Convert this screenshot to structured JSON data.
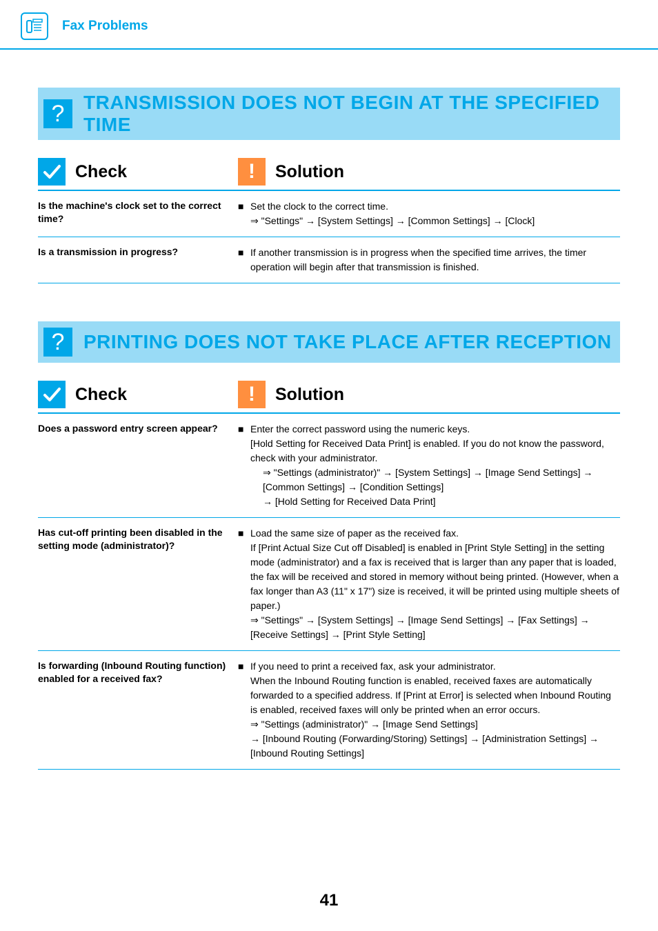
{
  "header": {
    "title": "Fax Problems"
  },
  "sections": [
    {
      "title": "TRANSMISSION DOES NOT BEGIN AT THE SPECIFIED TIME",
      "check_label": "Check",
      "solution_label": "Solution",
      "rows": [
        {
          "check": "Is the machine's clock set to the correct time?",
          "solution_main": "Set the clock to the correct time.",
          "solution_sub": "⇒ \"Settings\" → [System Settings]  → [Common Settings] → [Clock]"
        },
        {
          "check": "Is a transmission in progress?",
          "solution_main": "If another transmission is in progress when the specified time arrives, the timer operation will begin after that transmission is finished.",
          "solution_sub": ""
        }
      ]
    },
    {
      "title": "PRINTING DOES NOT TAKE PLACE AFTER RECEPTION",
      "check_label": "Check",
      "solution_label": "Solution",
      "rows": [
        {
          "check": "Does a password entry screen appear?",
          "solution_main": "Enter the correct password using the numeric keys.",
          "solution_extra": "[Hold Setting for Received Data Print] is enabled. If you do not know the password, check with your administrator.",
          "solution_sub": "⇒ \"Settings (administrator)\" → [System Settings] → [Image Send Settings] → [Common Settings] → [Condition Settings]\n→ [Hold Setting for Received Data Print]"
        },
        {
          "check": "Has cut-off printing been disabled in the setting mode (administrator)?",
          "solution_main": "Load the same size of paper as the received fax.",
          "solution_extra": "If [Print Actual Size Cut off Disabled] is enabled in [Print Style Setting] in the setting mode (administrator) and a fax is received that is larger than any paper that is loaded, the fax will be received and stored in memory without being printed. (However, when a fax longer than A3 (11\" x 17\") size is received, it will be printed using multiple sheets of paper.)",
          "solution_sub": "⇒ \"Settings\" → [System Settings] → [Image Send Settings] → [Fax Settings] → [Receive Settings] → [Print Style Setting]"
        },
        {
          "check": "Is forwarding (Inbound Routing function) enabled for a received fax?",
          "solution_main": "If you need to print a received fax, ask your administrator.",
          "solution_extra": "When the Inbound Routing function is enabled, received faxes are automatically forwarded to a specified address. If [Print at Error] is selected when Inbound Routing is enabled, received faxes will only be printed when an error occurs.",
          "solution_sub": "⇒ \"Settings (administrator)\" → [Image Send Settings]\n→ [Inbound Routing (Forwarding/Storing) Settings] → [Administration Settings] → [Inbound Routing Settings]"
        }
      ]
    }
  ],
  "page_number": "41"
}
